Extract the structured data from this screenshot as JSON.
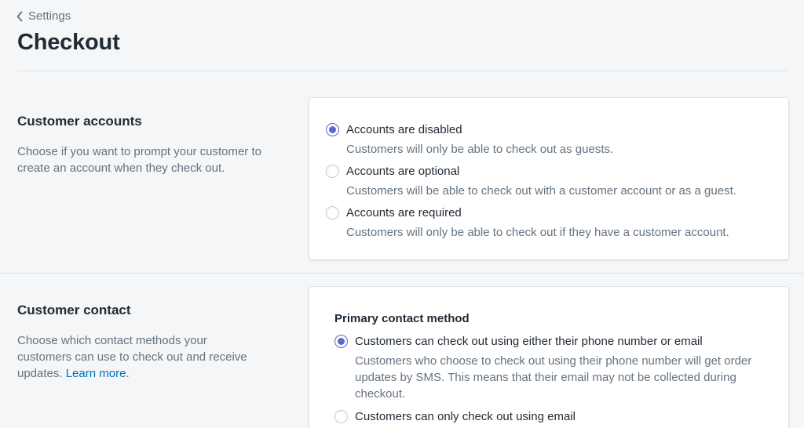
{
  "breadcrumb": {
    "label": "Settings"
  },
  "page": {
    "title": "Checkout"
  },
  "accounts": {
    "title": "Customer accounts",
    "description": "Choose if you want to prompt your customer to create an account when they check out.",
    "options": [
      {
        "label": "Accounts are disabled",
        "help": "Customers will only be able to check out as guests.",
        "checked": true
      },
      {
        "label": "Accounts are optional",
        "help": "Customers will be able to check out with a customer account or as a guest.",
        "checked": false
      },
      {
        "label": "Accounts are required",
        "help": "Customers will only be able to check out if they have a customer account.",
        "checked": false
      }
    ]
  },
  "contact": {
    "title": "Customer contact",
    "description": "Choose which contact methods your customers can use to check out and receive updates.",
    "learn_more": "Learn more",
    "period": ".",
    "subheading": "Primary contact method",
    "options": [
      {
        "label": "Customers can check out using either their phone number or email",
        "help": "Customers who choose to check out using their phone number will get order updates by SMS. This means that their email may not be collected during checkout.",
        "checked": true
      },
      {
        "label": "Customers can only check out using email",
        "help": "",
        "checked": false
      }
    ]
  },
  "colors": {
    "accent": "#5c6ac4",
    "link": "#006fbb",
    "text": "#212b36",
    "subdued": "#637381"
  }
}
